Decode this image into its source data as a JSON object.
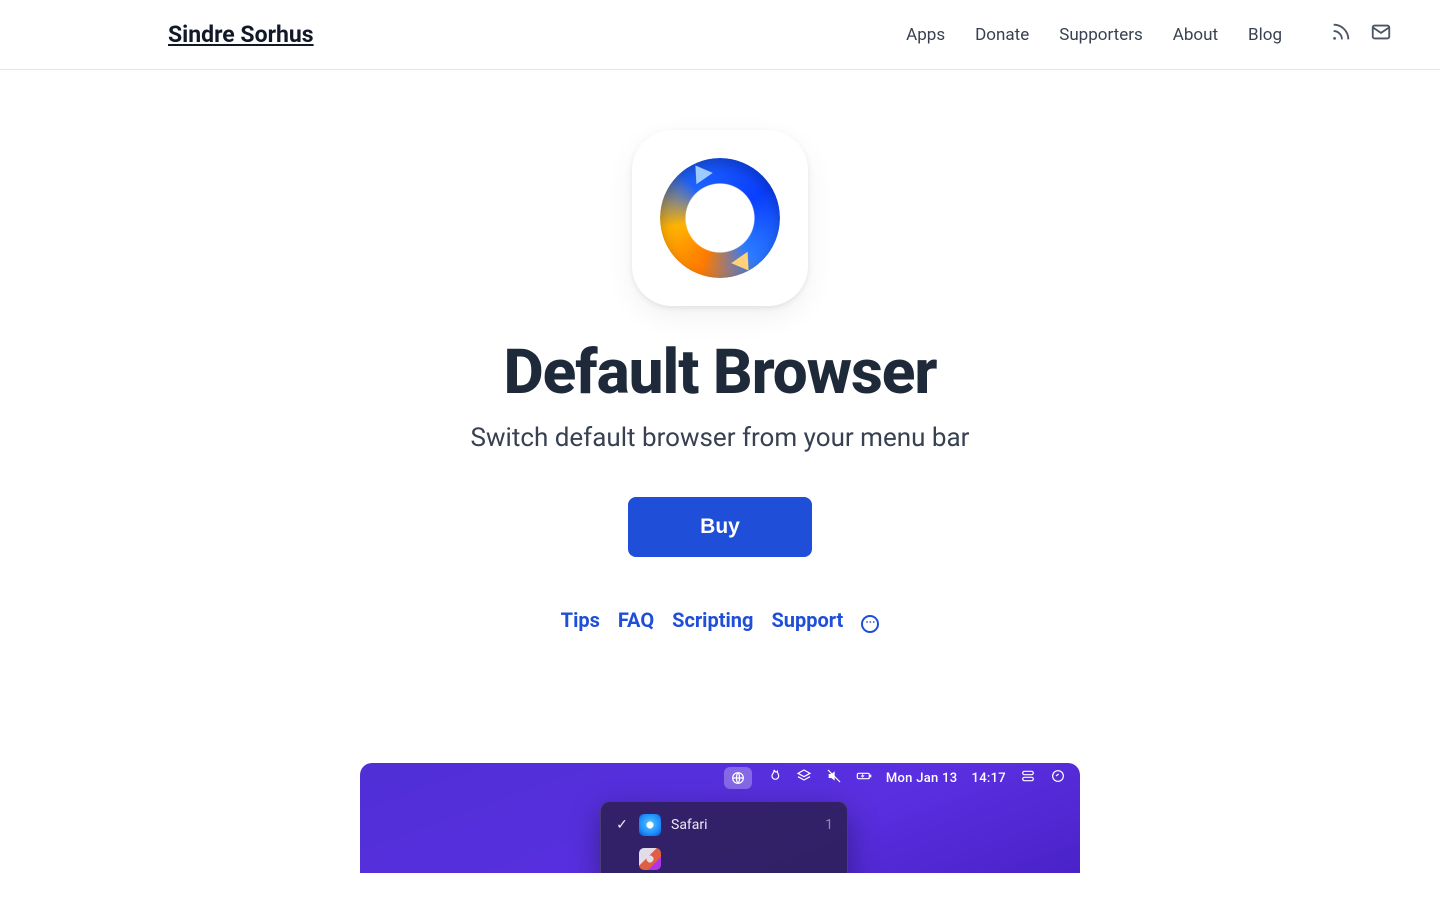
{
  "header": {
    "brand": "Sindre Sorhus",
    "nav": {
      "apps": "Apps",
      "donate": "Donate",
      "supporters": "Supporters",
      "about": "About",
      "blog": "Blog"
    }
  },
  "hero": {
    "title": "Default Browser",
    "subtitle": "Switch default browser from your menu bar",
    "buy_label": "Buy",
    "links": {
      "tips": "Tips",
      "faq": "FAQ",
      "scripting": "Scripting",
      "support": "Support"
    }
  },
  "screenshot": {
    "menubar": {
      "date": "Mon Jan 13",
      "time": "14:17"
    },
    "dropdown": {
      "items": [
        {
          "checked": true,
          "label": "Safari",
          "hint": "1"
        }
      ]
    }
  }
}
